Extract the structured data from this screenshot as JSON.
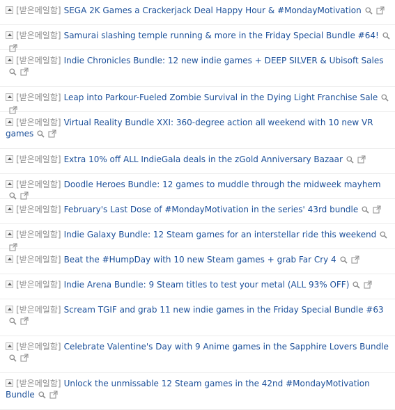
{
  "mailbox_label": "[받은메일함]",
  "items": [
    {
      "title": "SEGA 2K Games a Crackerjack Deal Happy Hour & #MondayMotivation",
      "lines": 1
    },
    {
      "title": "Samurai slashing temple running & more in the Friday Special Bundle #64!",
      "lines": 1
    },
    {
      "title": "Indie Chronicles Bundle: 12 new indie games + DEEP SILVER & Ubisoft Sales",
      "lines": 2
    },
    {
      "title": "Leap into Parkour-Fueled Zombie Survival in the Dying Light Franchise Sale",
      "lines": 1
    },
    {
      "title": "Virtual Reality Bundle XXI: 360-degree action all weekend with 10 new VR games",
      "lines": 2
    },
    {
      "title": "Extra 10% off ALL IndieGala deals in the zGold Anniversary Bazaar",
      "lines": 1
    },
    {
      "title": "Doodle Heroes Bundle: 12 games to muddle through the midweek mayhem",
      "lines": 1
    },
    {
      "title": "February's Last Dose of #MondayMotivation in the series' 43rd bundle",
      "lines": 1
    },
    {
      "title": "Indie Galaxy Bundle: 12 Steam games for an interstellar ride this weekend",
      "lines": 1
    },
    {
      "title": "Beat the #HumpDay with 10 new Steam games + grab Far Cry 4",
      "lines": 1
    },
    {
      "title": "Indie Arena Bundle: 9 Steam titles to test your metal (ALL 93% OFF)",
      "lines": 1
    },
    {
      "title": "Scream TGIF and grab 11 new indie games in the Friday Special Bundle #63",
      "lines": 2
    },
    {
      "title": "Celebrate Valentine's Day with 9 Anime games in the Sapphire Lovers Bundle",
      "lines": 2
    },
    {
      "title": "Unlock the unmissable 12 Steam games in the 42nd #MondayMotivation Bundle",
      "lines": 2
    }
  ]
}
